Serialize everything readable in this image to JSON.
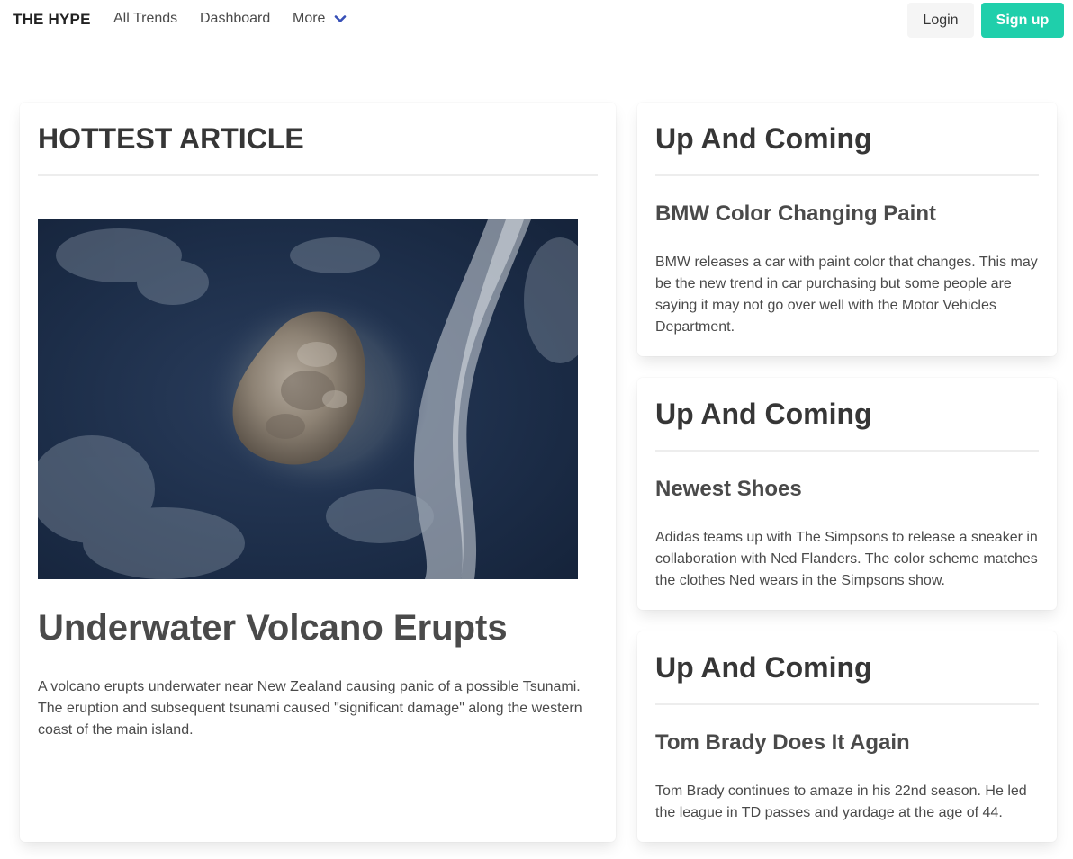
{
  "navbar": {
    "brand": "THE HYPE",
    "links": [
      "All Trends",
      "Dashboard",
      "More"
    ],
    "more_icon": "chevron-down-icon",
    "login_label": "Login",
    "signup_label": "Sign up",
    "accent_color": "#1fcfab",
    "chevron_color": "#3850b7"
  },
  "hottest": {
    "heading": "HOTTEST ARTICLE",
    "image": "volcano-satellite-image",
    "title": "Underwater Volcano Erupts",
    "body": "A volcano erupts underwater near New Zealand causing panic of a possible Tsunami. The eruption and subsequent tsunami caused \"significant damage\" along the western coast of the main island."
  },
  "upcoming": [
    {
      "heading": "Up And Coming",
      "title": "BMW Color Changing Paint",
      "body": "BMW releases a car with paint color that changes. This may be the new trend in car purchasing but some people are saying it may not go over well with the Motor Vehicles Department."
    },
    {
      "heading": "Up And Coming",
      "title": "Newest Shoes",
      "body": "Adidas teams up with The Simpsons to release a sneaker in collaboration with Ned Flanders. The color scheme matches the clothes Ned wears in the Simpsons show."
    },
    {
      "heading": "Up And Coming",
      "title": "Tom Brady Does It Again",
      "body": "Tom Brady continues to amaze in his 22nd season. He led the league in TD passes and yardage at the age of 44."
    }
  ]
}
